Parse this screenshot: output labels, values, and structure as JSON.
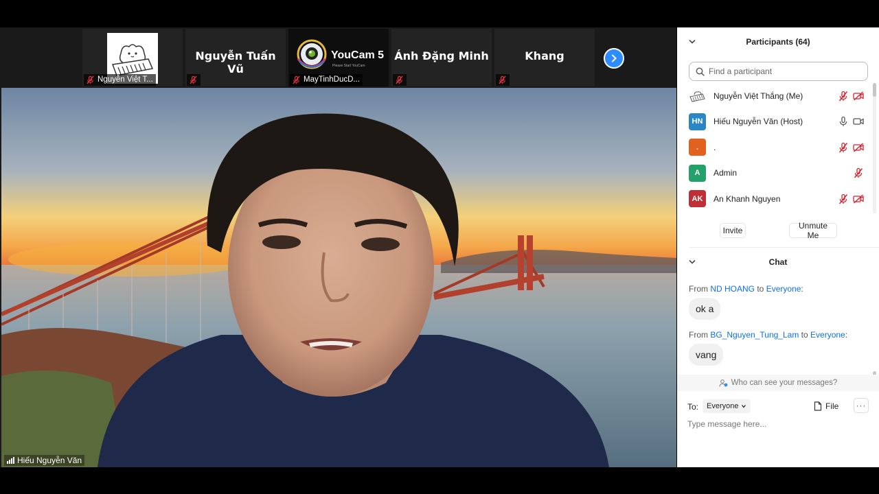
{
  "thumbnails": [
    {
      "label": "Nguyễn Việt T...",
      "display_name": "",
      "kind": "image"
    },
    {
      "label": "",
      "display_name": "Nguyễn Tuấn Vũ",
      "kind": "name"
    },
    {
      "label": "MayTinhDucD...",
      "display_name": "",
      "kind": "youcam"
    },
    {
      "label": "",
      "display_name": "Ánh Đặng Minh",
      "kind": "name"
    },
    {
      "label": "",
      "display_name": "Khang",
      "kind": "name"
    }
  ],
  "youcam": {
    "brand": "YouCam",
    "version": "5",
    "caption": "Please Start YouCam"
  },
  "speaker": {
    "name": "Hiếu Nguyễn Văn"
  },
  "participants": {
    "title": "Participants (64)",
    "search_placeholder": "Find a participant",
    "list": [
      {
        "initials": "",
        "name": "Nguyễn Việt Thắng (Me)",
        "color": "",
        "mic": "muted",
        "video": "off"
      },
      {
        "initials": "HN",
        "name": "Hiếu Nguyễn Văn (Host)",
        "color": "#2a86c4",
        "mic": "on",
        "video": "on"
      },
      {
        "initials": ".",
        "name": ".",
        "color": "#e0621e",
        "mic": "muted",
        "video": "off"
      },
      {
        "initials": "A",
        "name": "Admin",
        "color": "#24a06b",
        "mic": "muted",
        "video": "none"
      },
      {
        "initials": "AK",
        "name": "An Khanh Nguyen",
        "color": "#c02e36",
        "mic": "muted",
        "video": "off"
      }
    ],
    "invite_label": "Invite",
    "unmute_label": "Unmute Me"
  },
  "chat": {
    "title": "Chat",
    "messages": [
      {
        "from_prefix": "From ",
        "sender": "ND HOANG",
        "to_prefix": " to ",
        "recipient": "Everyone",
        "suffix": ":",
        "text": "ok a"
      },
      {
        "from_prefix": "From ",
        "sender": "BG_Nguyen_Tung_Lam",
        "to_prefix": " to ",
        "recipient": "Everyone",
        "suffix": ":",
        "text": "vang"
      }
    ],
    "who_can_see": "Who can see your messages?",
    "to_label": "To:",
    "to_value": "Everyone",
    "file_label": "File",
    "more_label": "···",
    "input_placeholder": "Type message here..."
  },
  "colors": {
    "accent": "#2d8cff",
    "muted_red": "#d6212d",
    "link_blue": "#0e71eb"
  }
}
